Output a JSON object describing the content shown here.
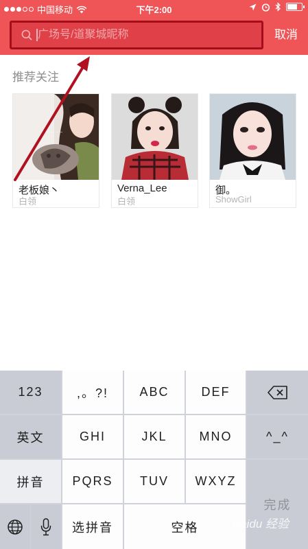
{
  "status_bar": {
    "carrier": "中国移动",
    "time": "下午2:00"
  },
  "search": {
    "placeholder": "广场号/道聚城昵称",
    "cancel_label": "取消"
  },
  "recommend": {
    "title": "推荐关注",
    "users": [
      {
        "name": "老板娘丶",
        "tag": "白领"
      },
      {
        "name": "Verna_Lee",
        "tag": "白领"
      },
      {
        "name": "御。",
        "tag": "ShowGirl"
      }
    ]
  },
  "keyboard": {
    "left_col": [
      "123",
      "英文",
      "拼音"
    ],
    "rows": [
      [
        ",。?!",
        "ABC",
        "DEF"
      ],
      [
        "GHI",
        "JKL",
        "MNO"
      ],
      [
        "PQRS",
        "TUV",
        "WXYZ"
      ]
    ],
    "select_pinyin": "选拼音",
    "space": "空格",
    "emoticon": "^_^",
    "done": "完成"
  },
  "watermark": "Baidu 经验",
  "colors": {
    "header": "#ef5456",
    "highlight_border": "#a40d1a",
    "arrow": "#b01020"
  }
}
